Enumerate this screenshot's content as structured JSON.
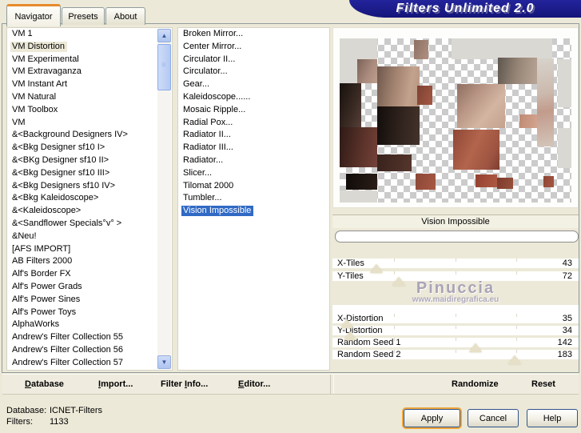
{
  "window": {
    "title": "Filters Unlimited 2.0"
  },
  "tabs": [
    {
      "label": "Navigator"
    },
    {
      "label": "Presets"
    },
    {
      "label": "About"
    }
  ],
  "category_list": {
    "selected_index": 1,
    "items": [
      "VM 1",
      "VM Distortion",
      "VM Experimental",
      "VM Extravaganza",
      "VM Instant Art",
      "VM Natural",
      "VM Toolbox",
      "VM",
      "&<Background Designers IV>",
      "&<Bkg Designer sf10 I>",
      "&<BKg Designer sf10 II>",
      "&<Bkg Designer sf10 III>",
      "&<Bkg Designers sf10 IV>",
      "&<Bkg Kaleidoscope>",
      "&<Kaleidoscope>",
      "&<Sandflower Specials°v° >",
      "&Neu!",
      "[AFS IMPORT]",
      "AB Filters 2000",
      "Alf's Border FX",
      "Alf's Power Grads",
      "Alf's Power Sines",
      "Alf's Power Toys",
      "AlphaWorks",
      "Andrew's Filter Collection 55",
      "Andrew's Filter Collection 56",
      "Andrew's Filter Collection 57"
    ]
  },
  "filter_list": {
    "selected_index": 14,
    "items": [
      "Broken Mirror...",
      "Center Mirror...",
      "Circulator II...",
      "Circulator...",
      "Gear...",
      "Kaleidoscope......",
      "Mosaic Ripple...",
      "Radial Pox...",
      "Radiator II...",
      "Radiator III...",
      "Radiator...",
      "Slicer...",
      "Tilomat 2000",
      "Tumbler...",
      "Vision Impossible"
    ]
  },
  "preview": {
    "caption": "Vision Impossible"
  },
  "sliders": [
    {
      "label": "X-Tiles",
      "value": "43",
      "thumb_pct": 18
    },
    {
      "label": "Y-Tiles",
      "value": "72",
      "thumb_pct": 27
    },
    {
      "label": "X-Distortion",
      "value": "35",
      "thumb_pct": 6
    },
    {
      "label": "Y-Distortion",
      "value": "34",
      "thumb_pct": 7
    },
    {
      "label": "Random Seed 1",
      "value": "142",
      "thumb_pct": 58
    },
    {
      "label": "Random Seed 2",
      "value": "183",
      "thumb_pct": 74
    }
  ],
  "watermark": {
    "name": "Pinuccia",
    "url": "www.maidiregrafica.eu"
  },
  "toolbar_items": [
    {
      "pre": "",
      "u": "D",
      "post": "atabase"
    },
    {
      "pre": "",
      "u": "I",
      "post": "mport..."
    },
    {
      "pre": "Filter ",
      "u": "I",
      "post": "nfo..."
    },
    {
      "pre": "",
      "u": "E",
      "post": "ditor..."
    },
    {
      "pre": "Randomize",
      "u": "",
      "post": ""
    },
    {
      "pre": "Reset",
      "u": "",
      "post": ""
    }
  ],
  "status": {
    "database_label": "Database:",
    "database_value": "ICNET-Filters",
    "filters_label": "Filters:",
    "filters_value": "1133"
  },
  "buttons": {
    "apply": "Apply",
    "cancel": "Cancel",
    "help": "Help"
  },
  "colors": {
    "selection_blue": "#316ac5",
    "banner_navy": "#1b1b8c",
    "tab_accent_orange": "#e68b2c",
    "dialog_beige": "#ece9d8"
  }
}
